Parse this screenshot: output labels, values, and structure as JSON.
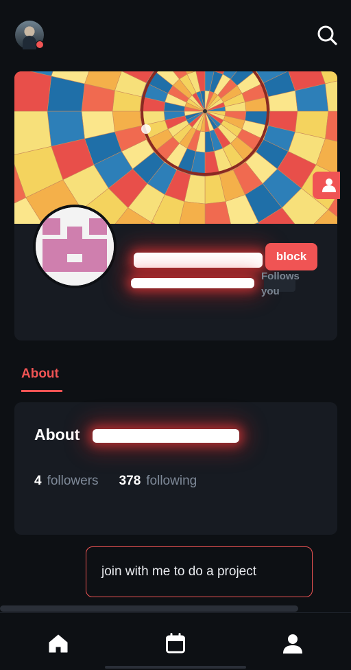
{
  "header": {
    "avatar_icon": "user-avatar",
    "search_icon": "search-icon"
  },
  "profile": {
    "actions": {
      "block_label": "block",
      "follow_icon": "add-user-icon"
    },
    "follows_you_label": "Follows you"
  },
  "tabs": [
    {
      "label": "About",
      "active": true
    }
  ],
  "about": {
    "title_prefix": "About",
    "followers_count": "4",
    "followers_label": "followers",
    "following_count": "378",
    "following_label": "following"
  },
  "bio": {
    "text": "join with me to do a project"
  },
  "bottom_nav": {
    "items": [
      {
        "icon": "home-icon"
      },
      {
        "icon": "calendar-icon"
      },
      {
        "icon": "profile-icon"
      }
    ]
  },
  "colors": {
    "background": "#0d1014",
    "card": "#171b22",
    "accent": "#f05454",
    "muted_text": "#7f8a99"
  }
}
